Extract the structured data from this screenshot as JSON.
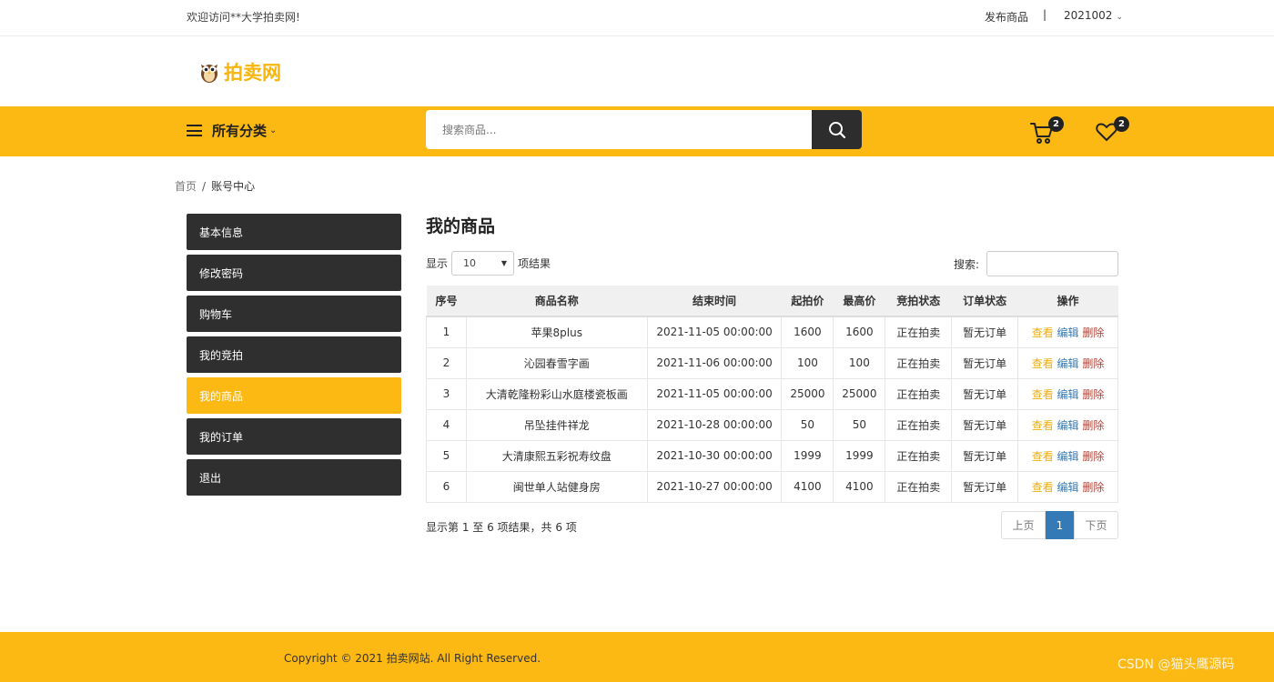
{
  "topbar": {
    "welcome": "欢迎访问**大学拍卖网!",
    "publish_label": "发布商品",
    "separator": "|",
    "username": "2021002"
  },
  "logo": {
    "text": "拍卖网"
  },
  "nav": {
    "category_label": "所有分类",
    "search_placeholder": "搜索商品...",
    "cart_count": "2",
    "fav_count": "2"
  },
  "breadcrumb": {
    "home": "首页",
    "divider": "/",
    "current": "账号中心"
  },
  "sidebar": {
    "items": [
      {
        "label": "基本信息"
      },
      {
        "label": "修改密码"
      },
      {
        "label": "购物车"
      },
      {
        "label": "我的竞拍"
      },
      {
        "label": "我的商品"
      },
      {
        "label": "我的订单"
      },
      {
        "label": "退出"
      }
    ],
    "active_index": 4
  },
  "main": {
    "title": "我的商品",
    "show_prefix": "显示",
    "page_size": "10",
    "show_suffix": "项结果",
    "search_label": "搜索:"
  },
  "table": {
    "headers": [
      "序号",
      "商品名称",
      "结束时间",
      "起拍价",
      "最高价",
      "竞拍状态",
      "订单状态",
      "操作"
    ],
    "rows": [
      {
        "no": "1",
        "name": "苹果8plus",
        "end": "2021-11-05 00:00:00",
        "start": "1600",
        "max": "1600",
        "status": "正在拍卖",
        "order": "暂无订单"
      },
      {
        "no": "2",
        "name": "沁园春雪字画",
        "end": "2021-11-06 00:00:00",
        "start": "100",
        "max": "100",
        "status": "正在拍卖",
        "order": "暂无订单"
      },
      {
        "no": "3",
        "name": "大清乾隆粉彩山水庭楼瓷板画",
        "end": "2021-11-05 00:00:00",
        "start": "25000",
        "max": "25000",
        "status": "正在拍卖",
        "order": "暂无订单"
      },
      {
        "no": "4",
        "name": "吊坠挂件祥龙",
        "end": "2021-10-28 00:00:00",
        "start": "50",
        "max": "50",
        "status": "正在拍卖",
        "order": "暂无订单"
      },
      {
        "no": "5",
        "name": "大清康熙五彩祝寿纹盘",
        "end": "2021-10-30 00:00:00",
        "start": "1999",
        "max": "1999",
        "status": "正在拍卖",
        "order": "暂无订单"
      },
      {
        "no": "6",
        "name": "闽世单人站健身房",
        "end": "2021-10-27 00:00:00",
        "start": "4100",
        "max": "4100",
        "status": "正在拍卖",
        "order": "暂无订单"
      }
    ],
    "actions": {
      "view": "查看",
      "edit": "编辑",
      "delete": "删除"
    }
  },
  "pagination": {
    "info": "显示第 1 至 6 项结果，共 6 项",
    "prev": "上页",
    "current": "1",
    "next": "下页"
  },
  "footer": {
    "copyright": "Copyright © 2021 拍卖网站. All Right Reserved.",
    "watermark": "CSDN @猫头鹰源码"
  },
  "colors": {
    "brand_yellow": "#fcb813",
    "dark": "#2f2f2f",
    "link_blue": "#337ab7",
    "link_red": "#b0453a",
    "name_orange": "#f0ad0b"
  }
}
